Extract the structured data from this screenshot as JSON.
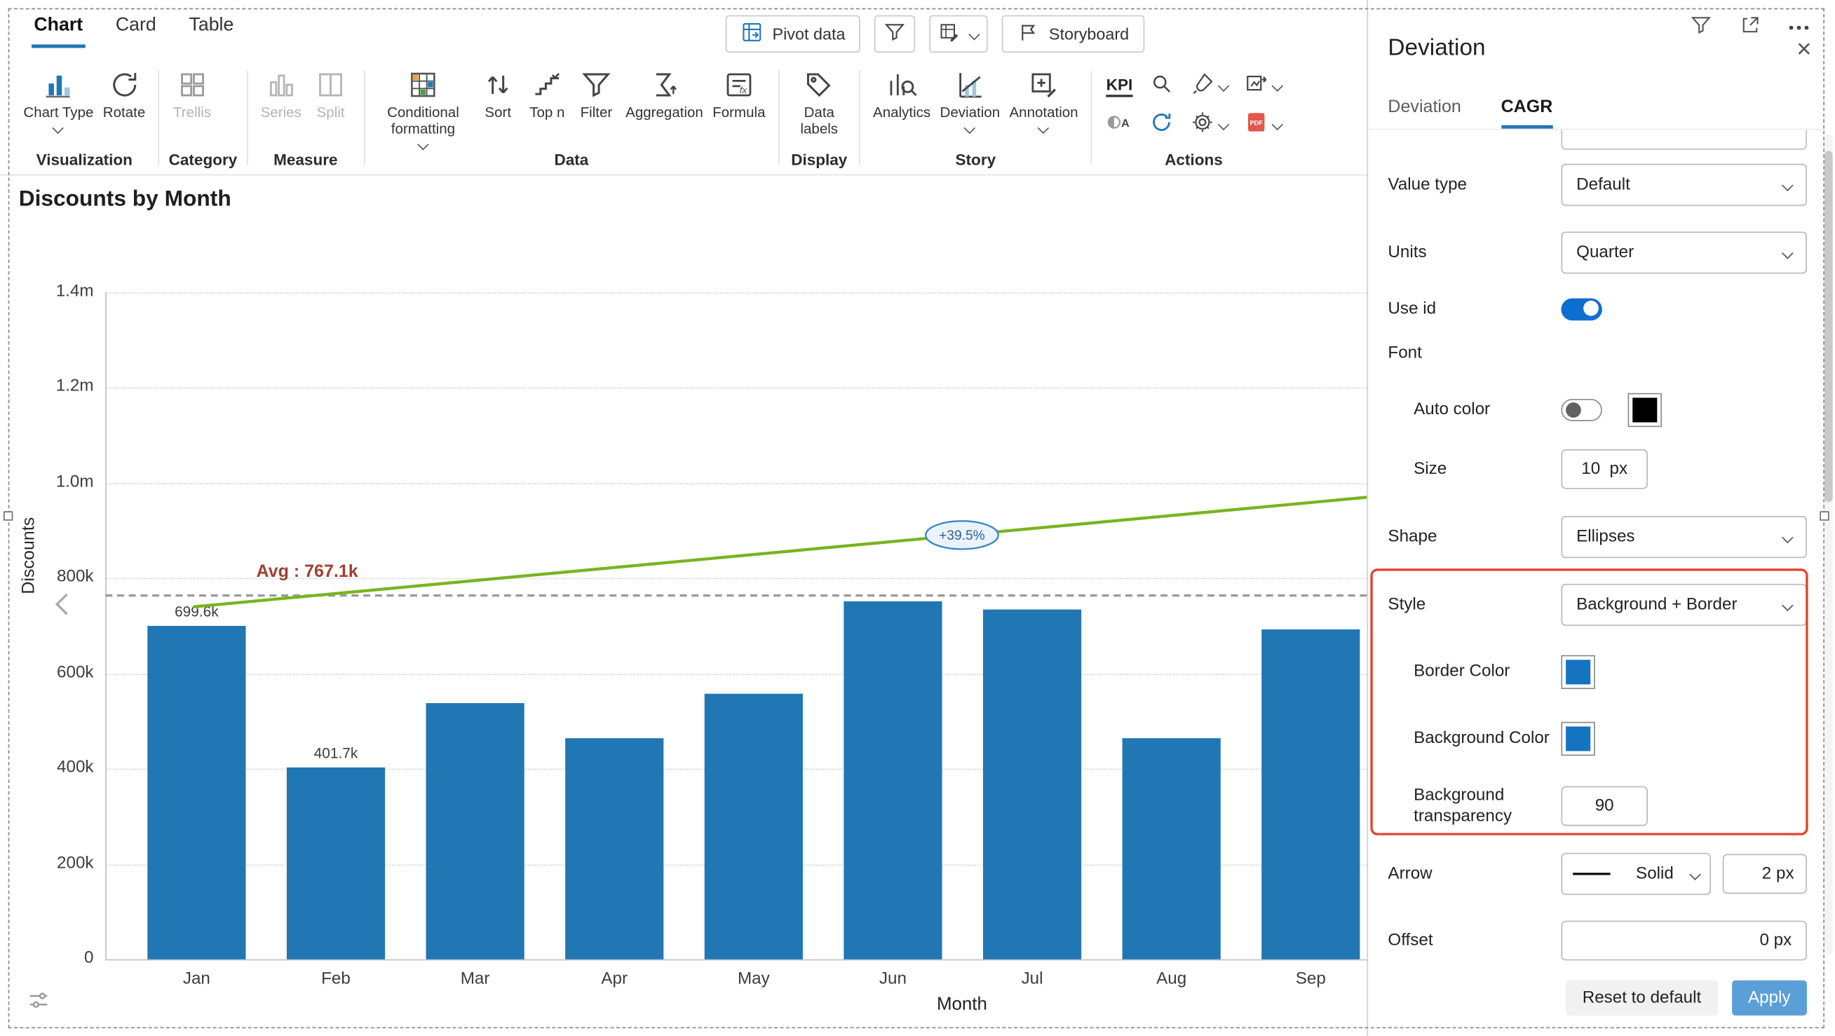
{
  "topbar": {
    "tabs": [
      {
        "label": "Chart"
      },
      {
        "label": "Card"
      },
      {
        "label": "Table"
      }
    ],
    "pivot_label": "Pivot data",
    "storyboard_label": "Storyboard"
  },
  "ribbon": {
    "visualization": {
      "label": "Visualization",
      "chart_type": "Chart Type",
      "rotate": "Rotate"
    },
    "category": {
      "label": "Category",
      "trellis": "Trellis"
    },
    "measure": {
      "label": "Measure",
      "series": "Series",
      "split": "Split"
    },
    "data": {
      "label": "Data",
      "conditional_formatting": "Conditional formatting",
      "sort": "Sort",
      "top_n": "Top n",
      "filter": "Filter",
      "aggregation": "Aggregation",
      "formula": "Formula"
    },
    "display": {
      "label": "Display",
      "data_labels": "Data labels"
    },
    "story": {
      "label": "Story",
      "analytics": "Analytics",
      "deviation": "Deviation",
      "annotation": "Annotation"
    },
    "actions": {
      "label": "Actions",
      "kpi": "KPI"
    }
  },
  "chart_data": {
    "type": "bar",
    "title": "Discounts by Month",
    "xlabel": "Month",
    "ylabel": "Discounts",
    "categories": [
      "Jan",
      "Feb",
      "Mar",
      "Apr",
      "May",
      "Jun",
      "Jul",
      "Aug",
      "Sep"
    ],
    "values": [
      699600,
      401700,
      537000,
      465000,
      558000,
      752000,
      735000,
      463000,
      693000
    ],
    "bar_labels": [
      "699.6k",
      "401.7k",
      "",
      "",
      "",
      "",
      "",
      "",
      ""
    ],
    "ylim": [
      0,
      1400000
    ],
    "ytick_values": [
      0,
      200000,
      400000,
      600000,
      800000,
      1000000,
      1200000,
      1400000
    ],
    "ytick_labels": [
      "0",
      "200k",
      "400k",
      "600k",
      "800k",
      "1.0m",
      "1.2m",
      "1.4m"
    ],
    "bar_color": "#2077b4",
    "grid": true,
    "legend": "none",
    "avg_line": {
      "label": "Avg : 767.1k",
      "value": 767100,
      "color": "#a04030"
    },
    "trend_line": {
      "label": "+39.5%",
      "start_value": 740000,
      "end_value": 970000,
      "color": "#79b41f",
      "badge_fill": "#eaf3fb",
      "badge_stroke": "#3a86c8",
      "badge_text_color": "#2a6099"
    }
  },
  "panel": {
    "title": "Deviation",
    "tabs": [
      {
        "label": "Deviation"
      },
      {
        "label": "CAGR"
      }
    ],
    "value_type_label": "Value type",
    "value_type_value": "Default",
    "units_label": "Units",
    "units_value": "Quarter",
    "use_id_label": "Use id",
    "font_label": "Font",
    "auto_color_label": "Auto color",
    "size_label": "Size",
    "size_value": "10",
    "size_unit": "px",
    "shape_label": "Shape",
    "shape_value": "Ellipses",
    "style_label": "Style",
    "style_value": "Background + Border",
    "border_color_label": "Border Color",
    "background_color_label": "Background Color",
    "background_transparency_label": "Background transparency",
    "background_transparency_value": "90",
    "arrow_label": "Arrow",
    "arrow_value": "Solid",
    "arrow_width": "2 px",
    "offset_label": "Offset",
    "offset_value": "0 px",
    "reset_label": "Reset to default",
    "apply_label": "Apply",
    "accent_color": "#1673c2",
    "font_swatch_color": "#000000",
    "toggle_on_color": "#0e6fd0",
    "highlight_color": "#e8402a"
  }
}
